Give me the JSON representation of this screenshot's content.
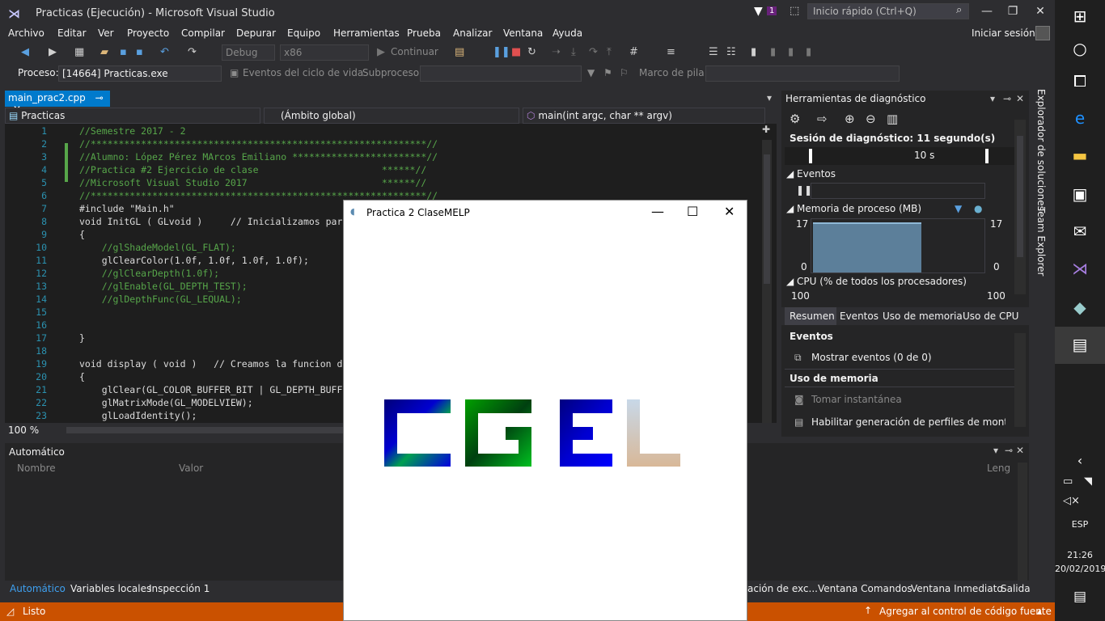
{
  "window": {
    "title": "Practicas (Ejecución) - Microsoft Visual Studio",
    "notif": "1",
    "quick_launch": "Inicio rápido (Ctrl+Q)",
    "signin": "Iniciar sesión"
  },
  "menu": [
    "Archivo",
    "Editar",
    "Ver",
    "Proyecto",
    "Compilar",
    "Depurar",
    "Equipo",
    "Herramientas",
    "Prueba",
    "Analizar",
    "Ventana",
    "Ayuda"
  ],
  "toolbar": {
    "config": "Debug",
    "platform": "x86",
    "continue": "Continuar"
  },
  "toolbar2": {
    "process_label": "Proceso:",
    "process_value": "[14664] Practicas.exe",
    "lifecycle": "Eventos del ciclo de vida",
    "thread": "Subproceso:",
    "stack": "Marco de pila:"
  },
  "editor": {
    "tab": "main_prac2.cpp",
    "nav_project": "Practicas",
    "nav_scope": "(Ámbito global)",
    "nav_func": "main(int argc, char ** argv)",
    "zoom": "100 %",
    "lines": [
      {
        "n": "1",
        "t": "//Semestre 2017 - 2",
        "c": "cm"
      },
      {
        "n": "2",
        "t": "//************************************************************//",
        "c": "cm"
      },
      {
        "n": "3",
        "t": "//Alumno: López Pérez MArcos Emiliano ************************//",
        "c": "cm"
      },
      {
        "n": "4",
        "t": "//Practica #2 Ejercicio de clase                      ******//",
        "c": "cm"
      },
      {
        "n": "5",
        "t": "//Microsoft Visual Studio 2017                        ******//",
        "c": "cm"
      },
      {
        "n": "6",
        "t": "//************************************************************//",
        "c": "cm"
      },
      {
        "n": "7",
        "t": "#include \"Main.h\"",
        "c": ""
      },
      {
        "n": "8",
        "t": "void InitGL ( GLvoid )     // Inicializamos par",
        "c": ""
      },
      {
        "n": "9",
        "t": "{",
        "c": ""
      },
      {
        "n": "10",
        "t": "    //glShadeModel(GL_FLAT);",
        "c": "cm"
      },
      {
        "n": "11",
        "t": "    glClearColor(1.0f, 1.0f, 1.0f, 1.0f);",
        "c": ""
      },
      {
        "n": "12",
        "t": "    //glClearDepth(1.0f);",
        "c": "cm"
      },
      {
        "n": "13",
        "t": "    //glEnable(GL_DEPTH_TEST);",
        "c": "cm"
      },
      {
        "n": "14",
        "t": "    //glDepthFunc(GL_LEQUAL);",
        "c": "cm"
      },
      {
        "n": "15",
        "t": "",
        "c": ""
      },
      {
        "n": "16",
        "t": "",
        "c": ""
      },
      {
        "n": "17",
        "t": "}",
        "c": ""
      },
      {
        "n": "18",
        "t": "",
        "c": ""
      },
      {
        "n": "19",
        "t": "void display ( void )   // Creamos la funcion d",
        "c": ""
      },
      {
        "n": "20",
        "t": "{",
        "c": ""
      },
      {
        "n": "21",
        "t": "    glClear(GL_COLOR_BUFFER_BIT | GL_DEPTH_BUFF",
        "c": ""
      },
      {
        "n": "22",
        "t": "    glMatrixMode(GL_MODELVIEW);",
        "c": ""
      },
      {
        "n": "23",
        "t": "    glLoadIdentity();",
        "c": ""
      }
    ]
  },
  "diag": {
    "title": "Herramientas de diagnóstico",
    "session": "Sesión de diagnóstico: 11 segundo(s)",
    "time": "10 s",
    "events": "Eventos",
    "memory": "Memoria de proceso (MB)",
    "mem_max": "17",
    "mem_min": "0",
    "cpu": "CPU (% de todos los procesadores)",
    "cpu_max": "100",
    "tabs": [
      "Resumen",
      "Eventos",
      "Uso de memoria",
      "Uso de CPU"
    ],
    "sec_events": "Eventos",
    "show_events": "Mostrar eventos (0 de 0)",
    "sec_mem": "Uso de memoria",
    "snapshot": "Tomar instantánea",
    "heap": "Habilitar generación de perfiles de montón (a"
  },
  "side": {
    "explorer": "Explorador de soluciones",
    "team": "Team Explorer"
  },
  "auto": {
    "title": "Automático",
    "col_name": "Nombre",
    "col_value": "Valor",
    "col_lang": "Leng"
  },
  "bottom_tabs": [
    "Automático",
    "Variables locales",
    "Inspección 1"
  ],
  "bottom_tabs_right": [
    "ación de exc...",
    "Ventana Comandos",
    "Ventana Inmediato",
    "Salida"
  ],
  "status": {
    "left": "Listo",
    "right": "Agregar al control de código fuente"
  },
  "glwin": {
    "title": "Practica 2 ClaseMELP"
  },
  "taskbar": {
    "lang": "ESP",
    "time": "21:26",
    "date": "20/02/2019"
  }
}
